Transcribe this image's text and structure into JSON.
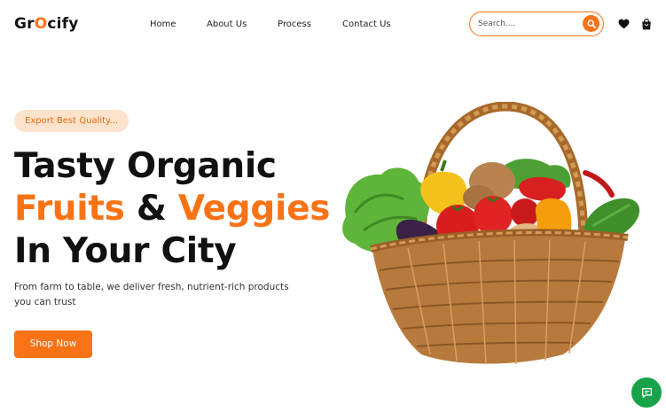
{
  "brand": {
    "logo_prefix": "Gr",
    "logo_accent": "O",
    "logo_suffix": "cify"
  },
  "nav": {
    "items": [
      "Home",
      "About Us",
      "Process",
      "Contact Us"
    ]
  },
  "search": {
    "placeholder": "Search....",
    "value": ""
  },
  "icons": {
    "search": "search-icon",
    "wishlist": "heart-icon",
    "cart": "shopping-bag-icon",
    "chat": "chat-icon"
  },
  "hero": {
    "badge": "Export Best Quality...",
    "headline_line1": "Tasty Organic",
    "headline_word1": "Fruits",
    "headline_amp": "&",
    "headline_word2": "Veggies",
    "headline_line3": "In Your City",
    "description": "From farm to table, we deliver fresh, nutrient-rich products you can trust",
    "cta_label": "Shop Now",
    "image_subject": "wicker-basket-of-vegetables"
  },
  "colors": {
    "accent": "#f97316",
    "badge_bg": "#fde3cc",
    "chat": "#16a34a",
    "text": "#111111"
  }
}
